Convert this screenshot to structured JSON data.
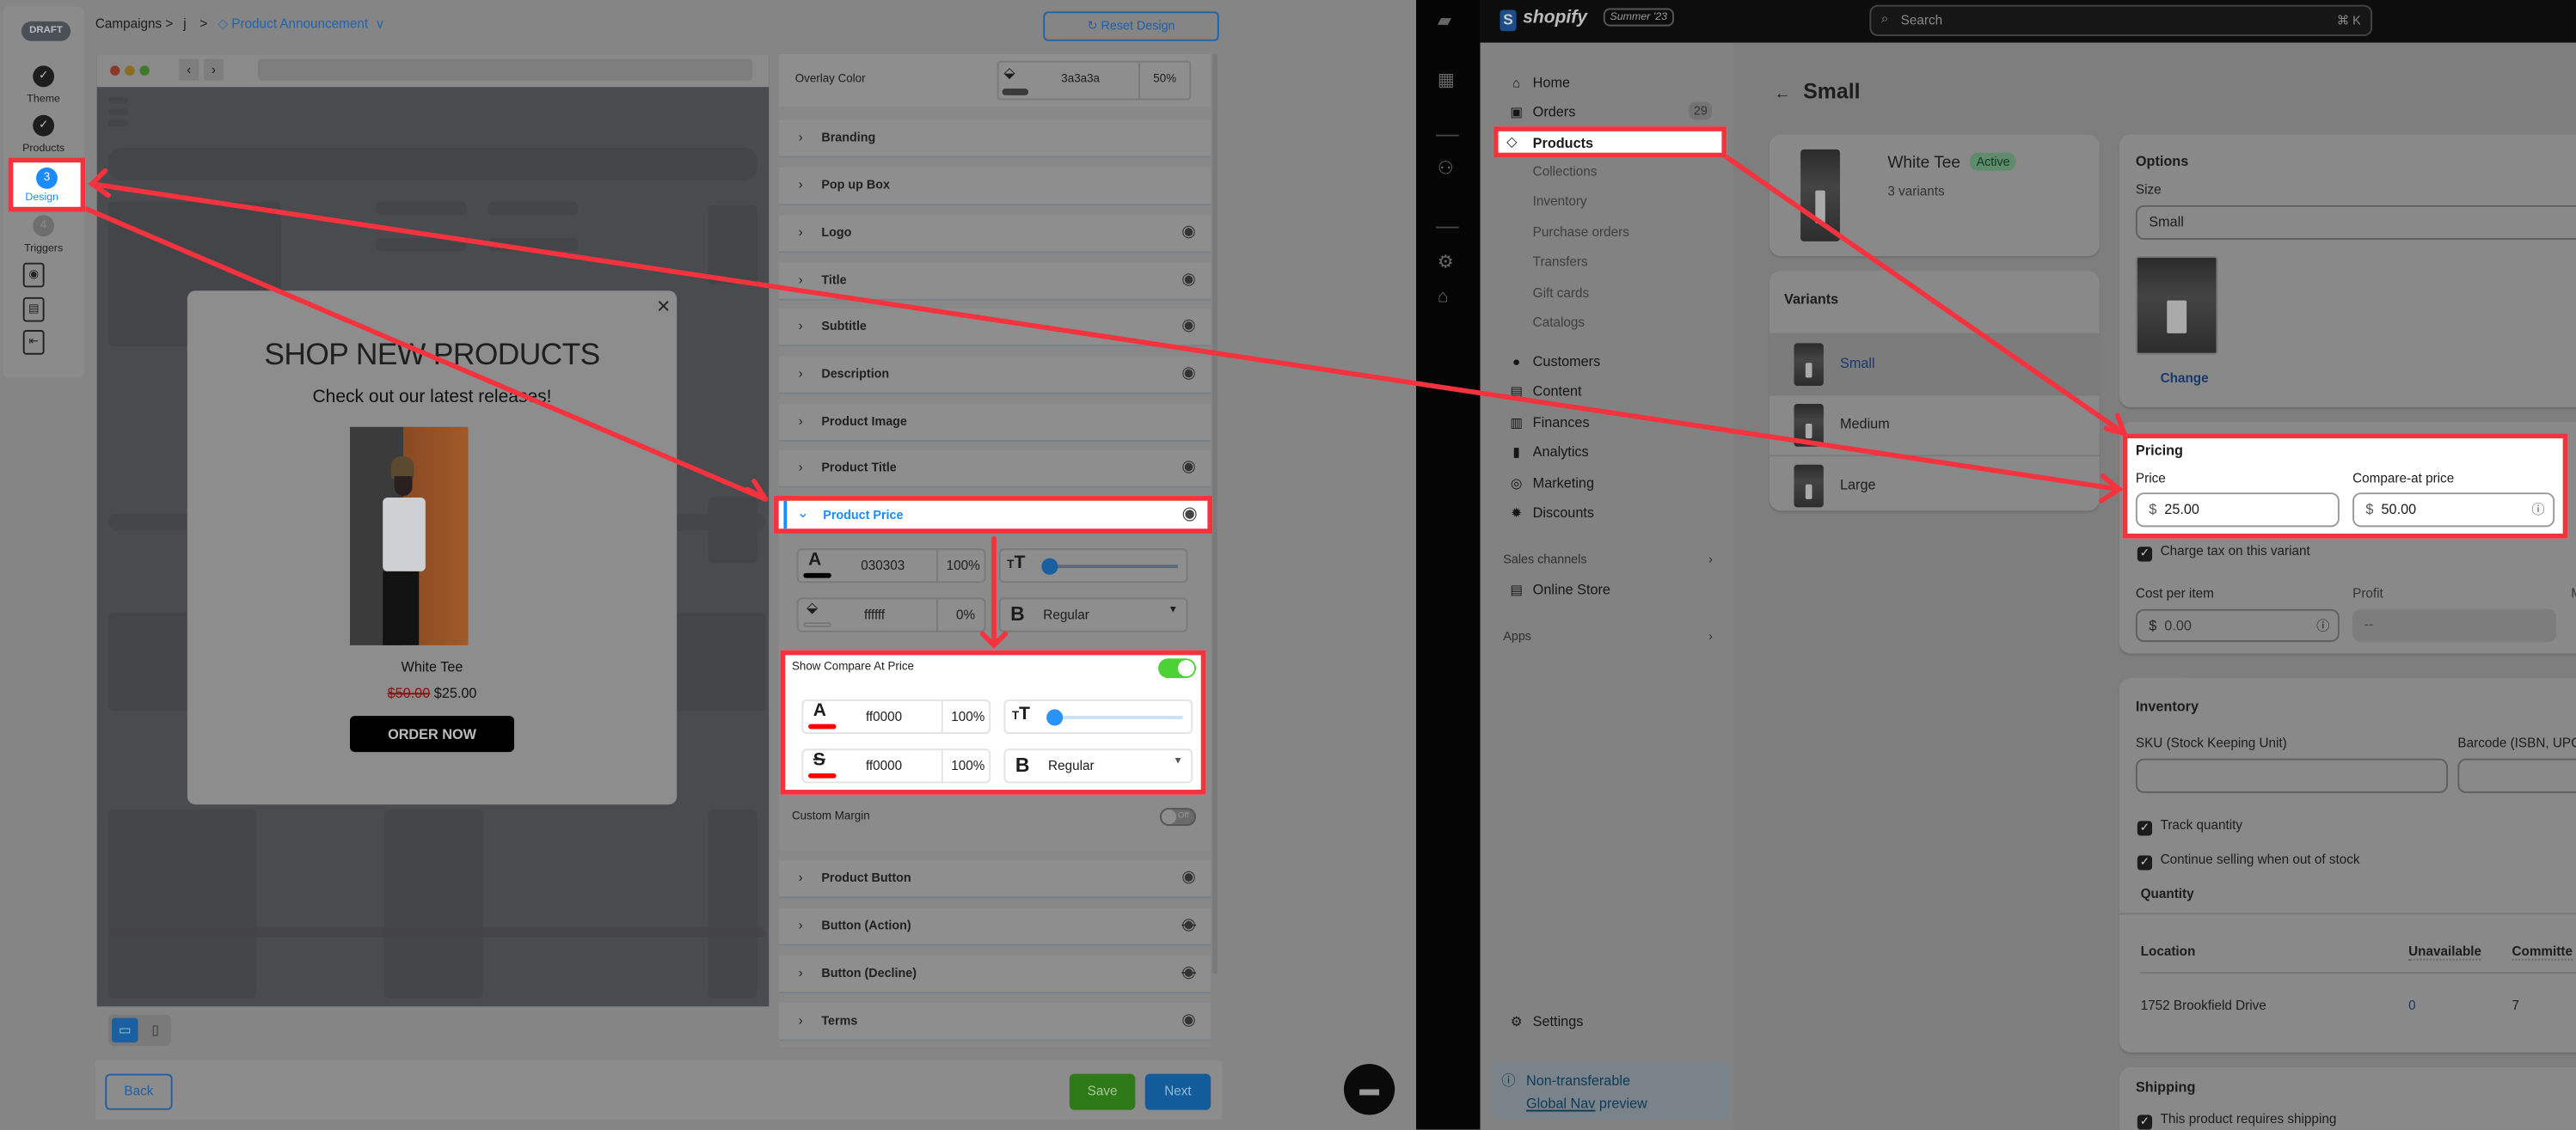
{
  "editor": {
    "status_badge": "DRAFT",
    "steps": [
      {
        "number": "✓",
        "label": "Theme",
        "state": "done"
      },
      {
        "number": "✓",
        "label": "Products",
        "state": "done"
      },
      {
        "number": "3",
        "label": "Design",
        "state": "active"
      },
      {
        "number": "4",
        "label": "Triggers",
        "state": "pending"
      }
    ],
    "side_icons": [
      "eye-icon",
      "file-icon",
      "exit-icon"
    ],
    "breadcrumb": {
      "root": "Campaigns",
      "separator": ">",
      "item": "j",
      "current": "Product Announcement",
      "current_chevron": "v"
    },
    "reset_button": "Reset Design",
    "preview": {
      "popup_title": "SHOP NEW PRODUCTS",
      "popup_subtitle": "Check out our latest releases!",
      "product_name": "White Tee",
      "compare_price": "$50.00",
      "price": "$25.00",
      "cta": "ORDER NOW",
      "close": "×"
    },
    "overlay": {
      "label": "Overlay Color",
      "hex": "3a3a3a",
      "opacity": "50%"
    },
    "sections": [
      {
        "label": "Branding",
        "eye": false
      },
      {
        "label": "Pop up Box",
        "eye": false
      },
      {
        "label": "Logo",
        "eye": true
      },
      {
        "label": "Title",
        "eye": true
      },
      {
        "label": "Subtitle",
        "eye": true
      },
      {
        "label": "Description",
        "eye": true
      },
      {
        "label": "Product Image",
        "eye": false
      },
      {
        "label": "Product Title",
        "eye": true
      }
    ],
    "product_price": {
      "label": "Product Price",
      "text_color": "030303",
      "text_opacity": "100%",
      "bg_color": "ffffff",
      "bg_opacity": "0%",
      "font_weight": "Regular",
      "size_slider_fraction": 0.05
    },
    "compare_at": {
      "label": "Show Compare At Price",
      "enabled": true,
      "text_color": "ff0000",
      "text_opacity": "100%",
      "strike_color": "ff0000",
      "strike_opacity": "100%",
      "font_weight": "Regular",
      "size_slider_fraction": 0.05
    },
    "custom_margin": {
      "label": "Custom Margin",
      "toggle": "Off"
    },
    "sections_after": [
      {
        "label": "Product Button",
        "eye": "visible"
      },
      {
        "label": "Button (Action)",
        "eye": "hidden"
      },
      {
        "label": "Button (Decline)",
        "eye": "hidden"
      },
      {
        "label": "Terms",
        "eye": "visible"
      }
    ],
    "footer": {
      "back": "Back",
      "save": "Save",
      "next": "Next"
    },
    "colors": {
      "accent": "#1a8cff",
      "save": "#4caf2a",
      "highlight": "#f5333f",
      "toggle_on": "#4cd137"
    }
  },
  "shopify": {
    "brand": "shopify",
    "edition": "Summer '23",
    "search_placeholder": "Search",
    "search_shortcut": "⌘ K",
    "nav": [
      {
        "label": "Home",
        "icon": "home-icon",
        "glyph": "⌂"
      },
      {
        "label": "Orders",
        "icon": "orders-icon",
        "glyph": "▣",
        "badge": "29"
      },
      {
        "label": "Products",
        "icon": "tag-icon",
        "glyph": "◇",
        "active": true
      }
    ],
    "products_sub": [
      "Collections",
      "Inventory",
      "Purchase orders",
      "Transfers",
      "Gift cards",
      "Catalogs"
    ],
    "nav2": [
      {
        "label": "Customers",
        "icon": "person-icon",
        "glyph": "●"
      },
      {
        "label": "Content",
        "icon": "content-icon",
        "glyph": "▤"
      },
      {
        "label": "Finances",
        "icon": "bank-icon",
        "glyph": "▥"
      },
      {
        "label": "Analytics",
        "icon": "chart-icon",
        "glyph": "▮"
      },
      {
        "label": "Marketing",
        "icon": "target-icon",
        "glyph": "◎"
      },
      {
        "label": "Discounts",
        "icon": "discount-icon",
        "glyph": "✹"
      }
    ],
    "sales_channels": "Sales channels",
    "online_store": "Online Store",
    "apps": "Apps",
    "settings": "Settings",
    "notice": {
      "line1": "Non-transferable",
      "link": "Global Nav",
      "line2": " preview"
    },
    "page_title": "Small",
    "product": {
      "name": "White Tee",
      "status": "Active",
      "variants_count": "3 variants"
    },
    "variants_title": "Variants",
    "variants": [
      "Small",
      "Medium",
      "Large"
    ],
    "options": {
      "title": "Options",
      "size_label": "Size",
      "size_value": "Small",
      "change": "Change"
    },
    "pricing": {
      "title": "Pricing",
      "price_label": "Price",
      "price": "25.00",
      "compare_label": "Compare-at price",
      "compare": "50.00",
      "currency": "$"
    },
    "charge_tax": "Charge tax on this variant",
    "cost": {
      "label": "Cost per item",
      "value": "0.00",
      "profit_label": "Profit",
      "profit": "--",
      "margin_label": "M"
    },
    "inventory": {
      "title": "Inventory",
      "sku_label": "SKU (Stock Keeping Unit)",
      "barcode_label": "Barcode (ISBN, UPC",
      "track": "Track quantity",
      "continue": "Continue selling when out of stock",
      "quantity": "Quantity",
      "headers": [
        "Location",
        "Unavailable",
        "Committe"
      ],
      "rows": [
        [
          "1752 Brookfield Drive",
          "0",
          "7"
        ]
      ]
    },
    "shipping": {
      "title": "Shipping",
      "requires": "This product requires shipping"
    }
  }
}
